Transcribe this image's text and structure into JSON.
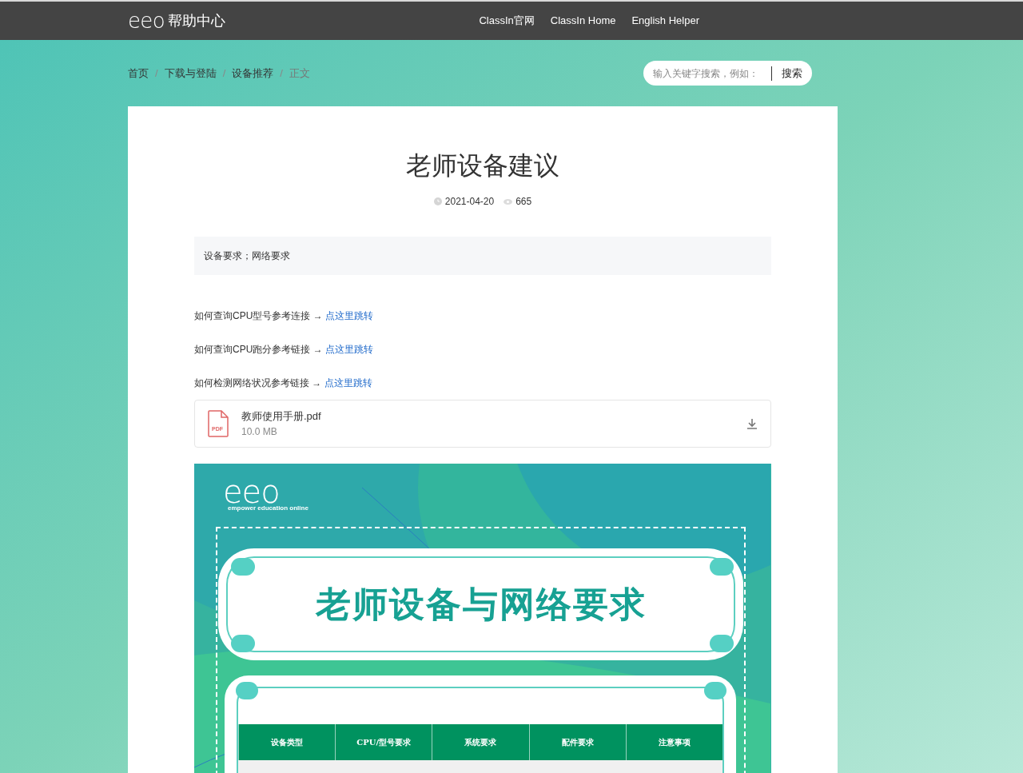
{
  "header": {
    "logo": "eeo",
    "title": "帮助中心",
    "nav": [
      "ClassIn官网",
      "ClassIn Home",
      "English Helper"
    ]
  },
  "breadcrumb": [
    {
      "label": "首页",
      "current": false
    },
    {
      "separator": "/",
      "label": "下载与登陆",
      "current": false
    },
    {
      "separator": "/",
      "label": "设备推荐",
      "current": false
    },
    {
      "separator": "/",
      "label": "正文",
      "current": true
    }
  ],
  "search": {
    "placeholder": "输入关键字搜索，例如：",
    "button": "搜索"
  },
  "article": {
    "title": "老师设备建议",
    "date": "2021-04-20",
    "views": "665",
    "summary": "设备要求；网络要求",
    "links": [
      {
        "text": "如何查询CPU型号参考连接 → ",
        "link": "点这里跳转"
      },
      {
        "text": "如何查询CPU跑分参考链接 → ",
        "link": "点这里跳转"
      },
      {
        "text": "如何检测网络状况参考链接 → ",
        "link": "点这里跳转"
      }
    ],
    "attachment": {
      "type": "PDF",
      "name": "教师使用手册.pdf",
      "size": "10.0 MB"
    },
    "infographic": {
      "logo": "eeo",
      "tagline": "empower education online",
      "title": "老师设备与网络要求",
      "columns": [
        "设备类型",
        "CPU/型号要求",
        "系统要求",
        "配件要求",
        "注意事项"
      ]
    }
  }
}
